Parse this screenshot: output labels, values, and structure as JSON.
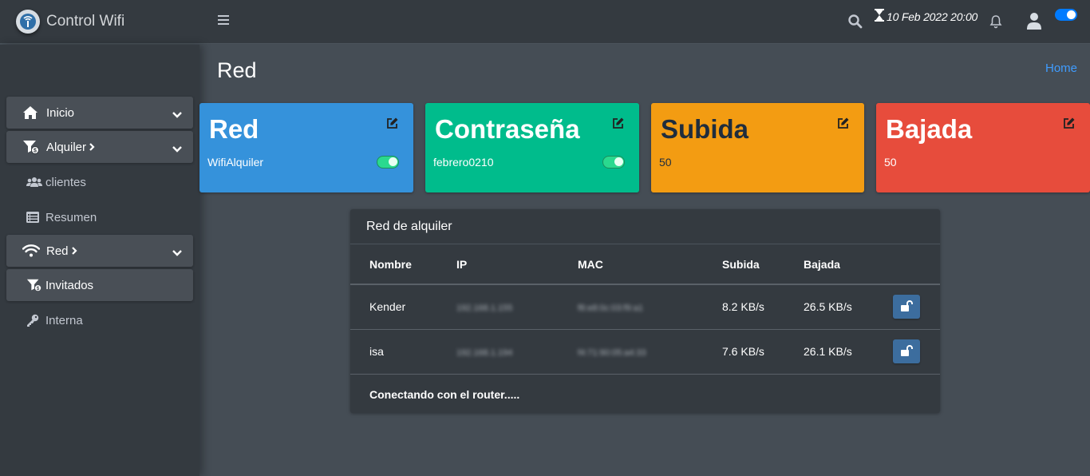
{
  "brand": {
    "title": "Control Wifi",
    "logo_icon": "wifi-antenna-icon"
  },
  "topbar": {
    "datetime": "10 Feb 2022 20:00",
    "icons": [
      "menu-icon",
      "search-icon",
      "hourglass-icon",
      "bell-icon",
      "user-icon"
    ],
    "toggle_color": "#007bff"
  },
  "sidebar": {
    "items": [
      {
        "label": "Inicio",
        "icon": "home-icon"
      },
      {
        "label": "Alquiler",
        "icon": "money-filter-icon"
      },
      {
        "label": "clientes",
        "icon": "users-icon"
      },
      {
        "label": "Resumen",
        "icon": "list-icon"
      },
      {
        "label": "Red",
        "icon": "wifi-icon"
      },
      {
        "label": "Invitados",
        "icon": "money-filter-icon"
      },
      {
        "label": "Interna",
        "icon": "key-icon"
      }
    ]
  },
  "page": {
    "title": "Red",
    "breadcrumb": "Home"
  },
  "boxes": [
    {
      "title": "Red",
      "value": "WifiAlquiler",
      "color": "#3592db",
      "toggle": true
    },
    {
      "title": "Contraseña",
      "value": "febrero0210",
      "color": "#00bc8c",
      "toggle": true
    },
    {
      "title": "Subida",
      "value": "50",
      "color": "#f39c12",
      "toggle": false
    },
    {
      "title": "Bajada",
      "value": "50",
      "color": "#e74c3c",
      "toggle": false
    }
  ],
  "table": {
    "title": "Red de alquiler",
    "columns": [
      "Nombre",
      "IP",
      "MAC",
      "Subida",
      "Bajada"
    ],
    "rows": [
      {
        "nombre": "Kender",
        "ip": "192.168.1.155",
        "mac": "f8:e8:0c:03:f9:a1",
        "subida": "8.2 KB/s",
        "bajada": "26.5 KB/s"
      },
      {
        "nombre": "isa",
        "ip": "192.168.1.194",
        "mac": "f4:71:90:05:a4:33",
        "subida": "7.6 KB/s",
        "bajada": "26.1 KB/s"
      }
    ],
    "status": "Conectando con el router....."
  }
}
